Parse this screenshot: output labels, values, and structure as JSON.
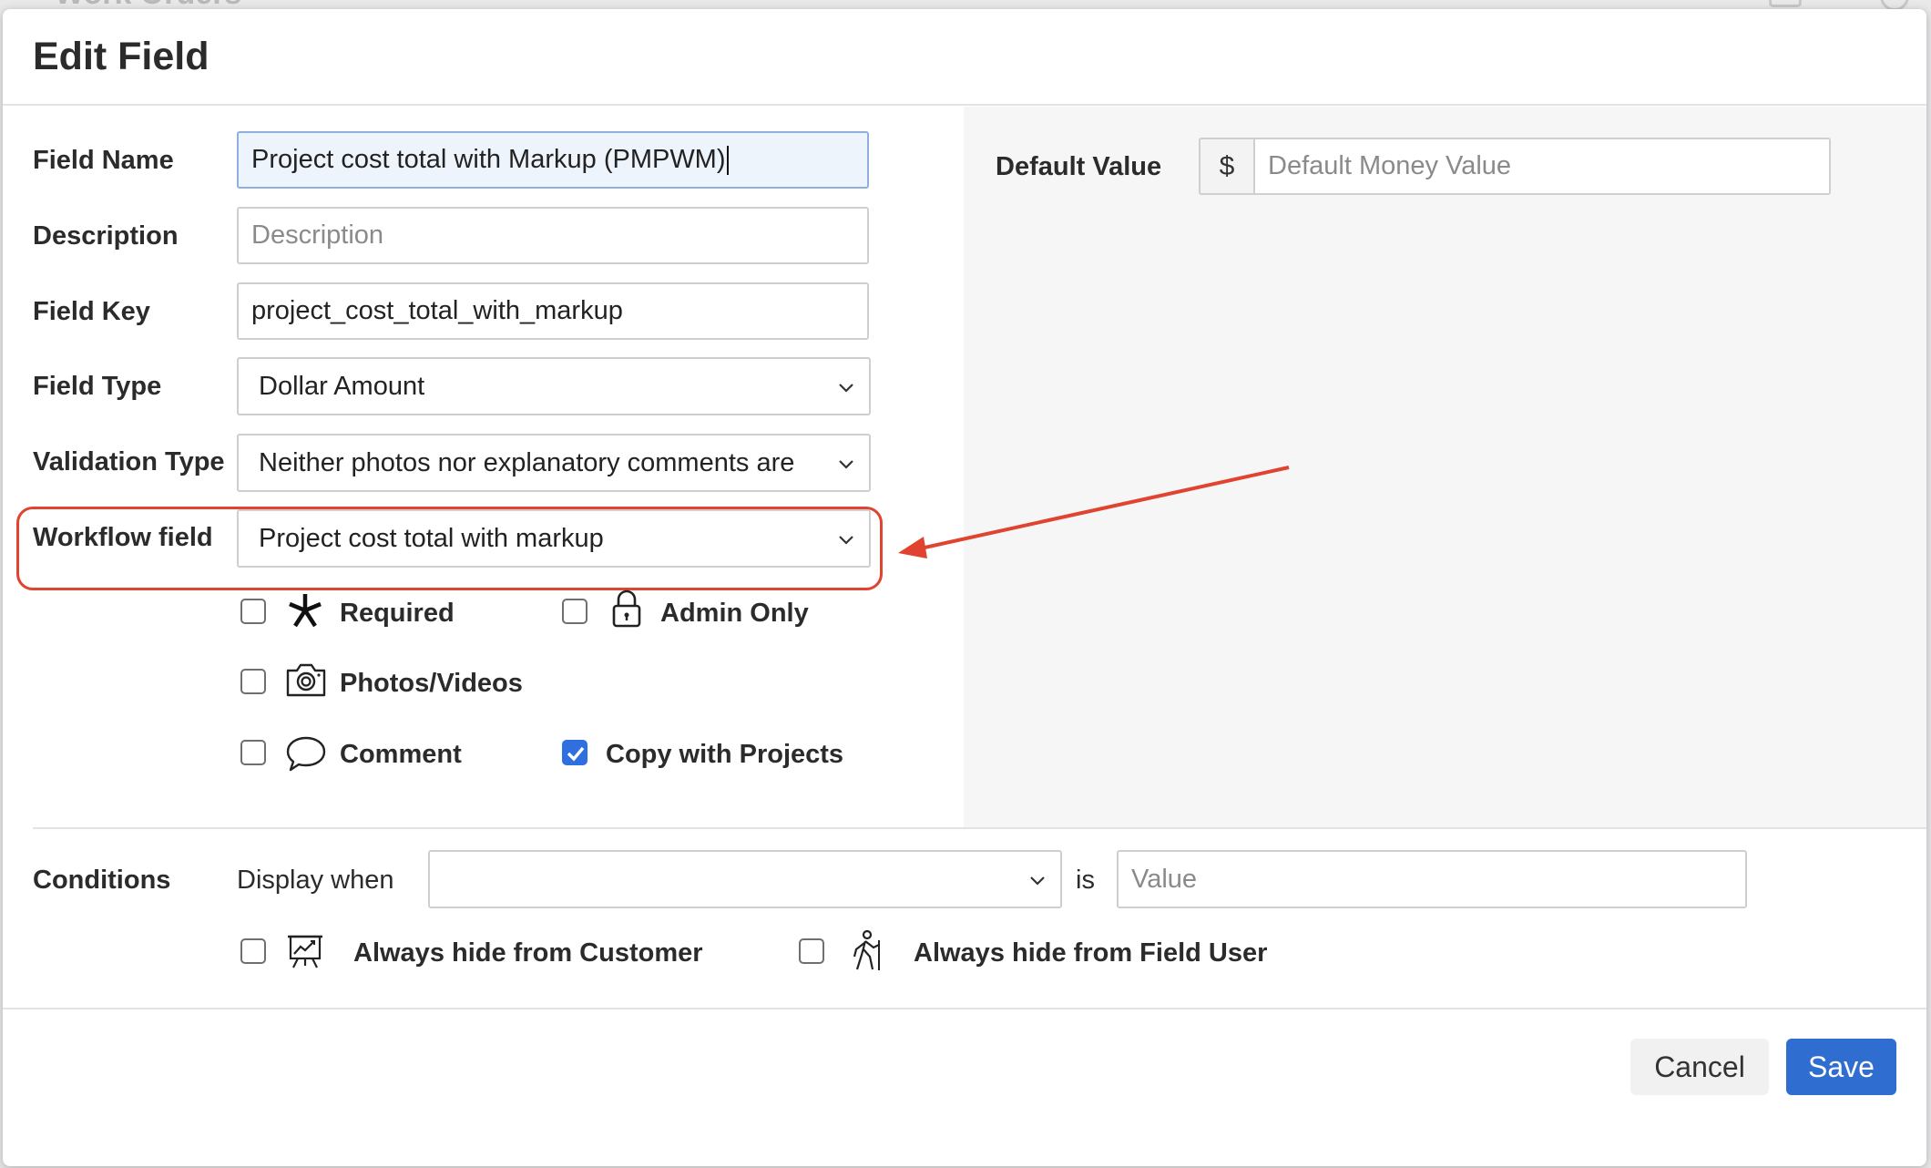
{
  "backdrop": {
    "title": "Work Orders"
  },
  "modal": {
    "title": "Edit Field"
  },
  "form": {
    "field_name": {
      "label": "Field Name",
      "value": "Project cost total with Markup (PMPWM)"
    },
    "description": {
      "label": "Description",
      "placeholder": "Description"
    },
    "field_key": {
      "label": "Field Key",
      "value": "project_cost_total_with_markup"
    },
    "field_type": {
      "label": "Field Type",
      "value": "Dollar Amount"
    },
    "validation_type": {
      "label": "Validation Type",
      "value": "Neither photos nor explanatory comments are"
    },
    "workflow_field": {
      "label": "Workflow field",
      "value": "Project cost total with markup"
    }
  },
  "options": {
    "required": {
      "label": "Required",
      "checked": false,
      "icon": "asterisk-icon"
    },
    "admin_only": {
      "label": "Admin Only",
      "checked": false,
      "icon": "lock-icon"
    },
    "photos_videos": {
      "label": "Photos/Videos",
      "checked": false,
      "icon": "camera-icon"
    },
    "comment": {
      "label": "Comment",
      "checked": false,
      "icon": "speech-bubble-icon"
    },
    "copy_with_projects": {
      "label": "Copy with Projects",
      "checked": true
    }
  },
  "default_value": {
    "label": "Default Value",
    "currency_symbol": "$",
    "placeholder": "Default Money Value"
  },
  "conditions": {
    "label": "Conditions",
    "display_when_label": "Display when",
    "display_when_value": "",
    "is_label": "is",
    "value_placeholder": "Value",
    "hide_customer": {
      "label": "Always hide from Customer",
      "checked": false,
      "icon": "presentation-chart-icon"
    },
    "hide_field_user": {
      "label": "Always hide from Field User",
      "checked": false,
      "icon": "hiker-icon"
    }
  },
  "footer": {
    "cancel_label": "Cancel",
    "save_label": "Save"
  },
  "colors": {
    "annotation": "#e0432f",
    "primary": "#2f6dd0",
    "checkbox_checked": "#2f6fe0"
  }
}
